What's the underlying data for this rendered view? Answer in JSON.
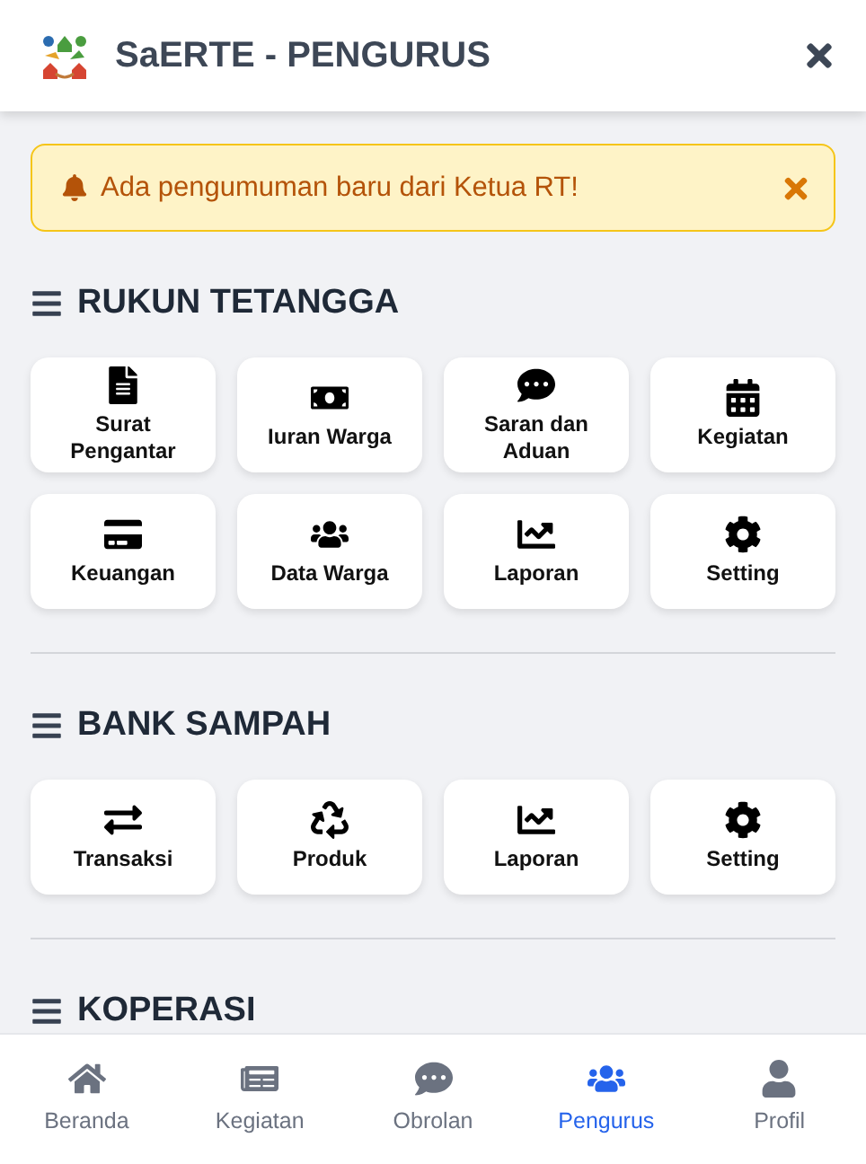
{
  "header": {
    "title": "SaERTE - PENGURUS"
  },
  "notice": {
    "text": "Ada pengumuman baru dari Ketua RT!"
  },
  "sections": [
    {
      "title": "RUKUN TETANGGA",
      "items": [
        "Surat Pengantar",
        "Iuran Warga",
        "Saran dan Aduan",
        "Kegiatan",
        "Keuangan",
        "Data Warga",
        "Laporan",
        "Setting"
      ]
    },
    {
      "title": "BANK SAMPAH",
      "items": [
        "Transaksi",
        "Produk",
        "Laporan",
        "Setting"
      ]
    },
    {
      "title": "KOPERASI"
    }
  ],
  "bottom_nav": [
    {
      "label": "Beranda",
      "selected": false
    },
    {
      "label": "Kegiatan",
      "selected": false
    },
    {
      "label": "Obrolan",
      "selected": false
    },
    {
      "label": "Pengurus",
      "selected": true
    },
    {
      "label": "Profil",
      "selected": false
    }
  ]
}
